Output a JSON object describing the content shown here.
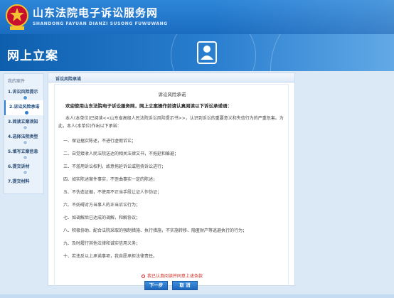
{
  "header": {
    "title": "山东法院电子诉讼服务网",
    "subtitle": "SHANDONG FAYUAN DIANZI SUSONG FUWUWANG",
    "emblem_icon": "court-emblem-icon"
  },
  "banner": {
    "title": "网上立案",
    "icon": "person-document-icon"
  },
  "sidebar": {
    "heading": "我的案件",
    "steps": [
      {
        "label": "1.诉讼风险提示",
        "state": "done"
      },
      {
        "label": "2.诉讼风险承诺",
        "state": "active"
      },
      {
        "label": "3.阅读立案须知",
        "state": "todo"
      },
      {
        "label": "4.选择法院类型",
        "state": "todo"
      },
      {
        "label": "5.填写立案信息",
        "state": "todo"
      },
      {
        "label": "6.提交诉材",
        "state": "todo"
      },
      {
        "label": "7.提交材料",
        "state": "todo"
      }
    ]
  },
  "main": {
    "tab_label": "诉讼风险承诺",
    "notice_title": "诉讼风险承诺",
    "intro": "欢迎使用山东法院电子诉讼服务网，网上立案操作前请认真阅读以下诉讼承诺语：",
    "paragraph": "本人(本单位)已阅读<<山东省高级人民法院诉讼风险提示书>>，认识到诉讼的重要意义和失信行为的严重危害。为此，本人(本单位)作出以下承诺：",
    "items": [
      "一、保证据实陈述，不进行虚假诉讼；",
      "二、自觉接收人民法院送达的相关法律文书，不拖延和躲避；",
      "三、不滥用诉讼权利，故意拖延诉讼或阻挠诉讼进行；",
      "四、如实陈述案件事实，不歪曲事实一定的陈述；",
      "五、不伪造证据，不使用不正当手段让证人作伪证；",
      "六、不妨碍对方当事人的正当诉讼行为；",
      "七、如调解后已达成的调解，和解协议；",
      "八、积极协助、配合法院采取的强制措施、执行措施，不实施转移、隐匿财产等逃避执行的行为；",
      "九、及时履行其他法律和诚实信用义务；",
      "十、若违反以上承诺事项，我自愿承担法律责任。"
    ],
    "agree_text": "我已认真阅读并同意上述条款",
    "next_button": "下一步",
    "cancel_button": "取  消"
  },
  "colors": {
    "header_blue": "#1a6cc0",
    "banner_blue": "#0d5fae",
    "agree_red": "#d0241b",
    "page_bg": "#dbe9f6"
  }
}
